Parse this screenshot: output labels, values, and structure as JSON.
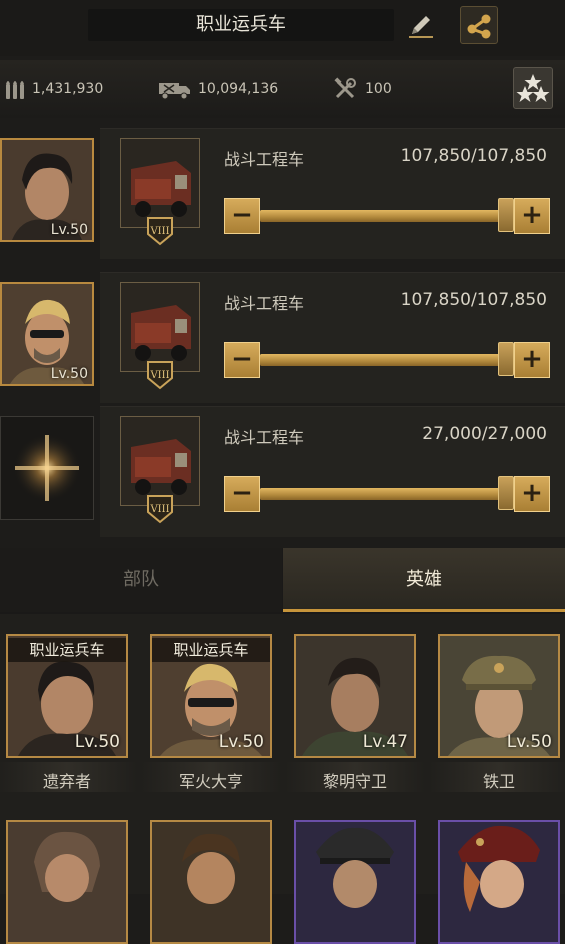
{
  "header": {
    "title": "职业运兵车"
  },
  "stats": [
    {
      "icon": "ammo-icon",
      "value": "1,431,930"
    },
    {
      "icon": "truck-load-icon",
      "value": "10,094,136"
    },
    {
      "icon": "tools-icon",
      "value": "100"
    }
  ],
  "slots": [
    {
      "hero_level": "Lv.50",
      "hero_present": true,
      "truck_name": "战斗工程车",
      "truck_rank": "VIII",
      "count": "107,850/107,850",
      "fill_fraction": 1.0
    },
    {
      "hero_level": "Lv.50",
      "hero_present": true,
      "truck_name": "战斗工程车",
      "truck_rank": "VIII",
      "count": "107,850/107,850",
      "fill_fraction": 1.0
    },
    {
      "hero_level": "",
      "hero_present": false,
      "truck_name": "战斗工程车",
      "truck_rank": "VIII",
      "count": "27,000/27,000",
      "fill_fraction": 1.0
    }
  ],
  "tabs": {
    "troops": "部队",
    "heroes": "英雄",
    "active": "heroes"
  },
  "heroes": [
    {
      "tag": "职业运兵车",
      "level": "Lv.50",
      "name": "遗弃者"
    },
    {
      "tag": "职业运兵车",
      "level": "Lv.50",
      "name": "军火大亨"
    },
    {
      "tag": "",
      "level": "Lv.47",
      "name": "黎明守卫"
    },
    {
      "tag": "",
      "level": "Lv.50",
      "name": "铁卫"
    }
  ],
  "colors": {
    "accent_gold": "#c7953b",
    "frame_gold": "#b58944",
    "frame_purple": "#6a4fa8",
    "background": "#1d1c1a"
  }
}
